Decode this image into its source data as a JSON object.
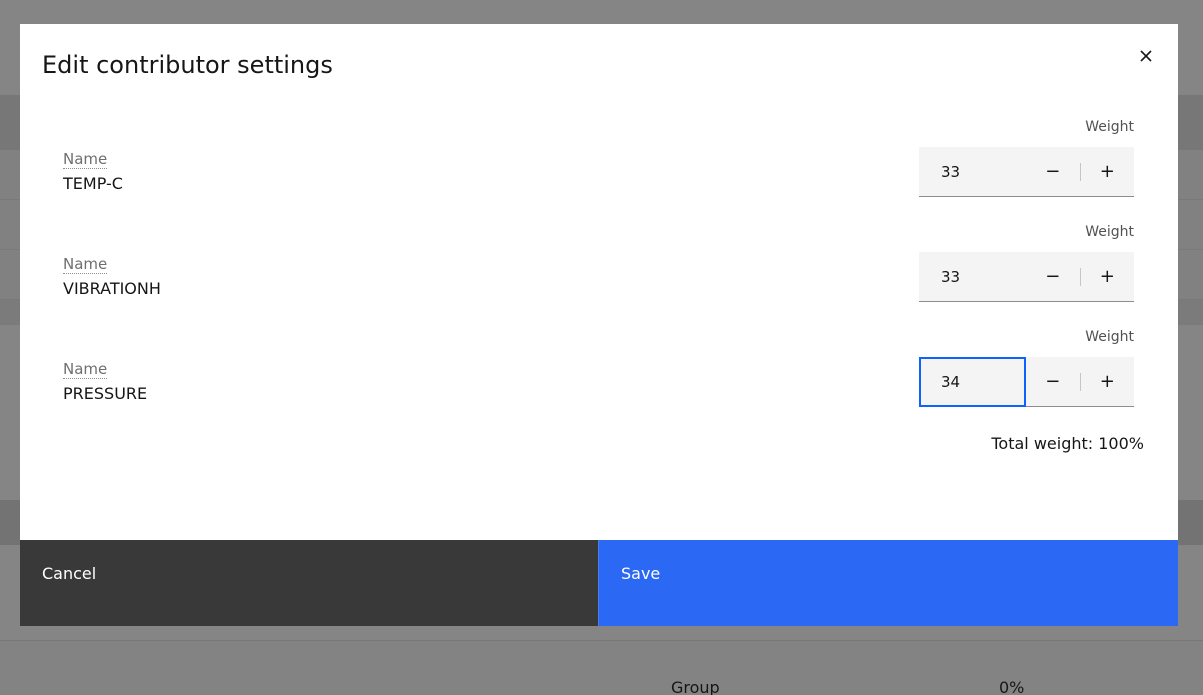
{
  "background": {
    "group_label": "Group",
    "percent_value": "0%"
  },
  "modal": {
    "title": "Edit contributor settings",
    "close_icon": "close-icon",
    "contributors": [
      {
        "name_label": "Name",
        "name": "TEMP-C",
        "weight_label": "Weight",
        "weight": "33"
      },
      {
        "name_label": "Name",
        "name": "VIBRATIONH",
        "weight_label": "Weight",
        "weight": "33"
      },
      {
        "name_label": "Name",
        "name": "PRESSURE",
        "weight_label": "Weight",
        "weight": "34"
      }
    ],
    "decrement_symbol": "−",
    "increment_symbol": "+",
    "total_weight": "Total weight: 100%",
    "cancel_label": "Cancel",
    "save_label": "Save",
    "colors": {
      "primary": "#2b68f3",
      "secondary": "#393939",
      "focus": "#0f62fe"
    }
  }
}
